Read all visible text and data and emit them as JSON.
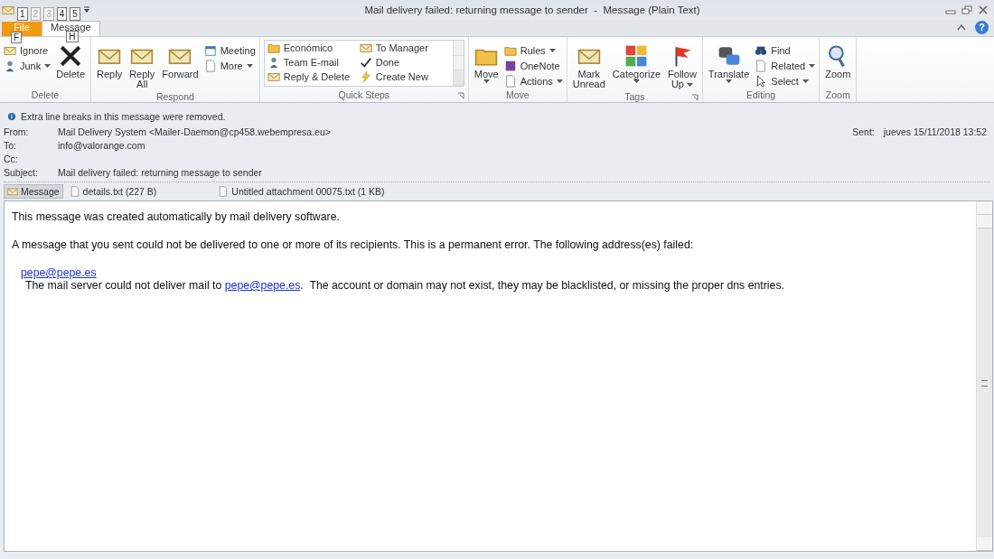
{
  "window": {
    "title": "Mail delivery failed: returning message to sender  -  Message (Plain Text)",
    "help": "?"
  },
  "quick_access": [
    {
      "keytip": "1",
      "disabled": false
    },
    {
      "keytip": "2",
      "disabled": true
    },
    {
      "keytip": "3",
      "disabled": true
    },
    {
      "keytip": "4",
      "disabled": false
    },
    {
      "keytip": "5",
      "disabled": false
    }
  ],
  "tabs": [
    {
      "label": "File",
      "kind": "file",
      "keytip": "F",
      "selected": false
    },
    {
      "label": "Message",
      "kind": "tab",
      "keytip": "H",
      "selected": true
    }
  ],
  "ribbon": [
    {
      "name": "Delete",
      "launcher": false,
      "items": [
        {
          "kind": "stack",
          "items": [
            {
              "label": "Ignore",
              "dropdown": false
            },
            {
              "label": "Junk",
              "dropdown": true
            }
          ]
        },
        {
          "kind": "large",
          "lines": [
            "Delete"
          ],
          "dropdown": false
        }
      ]
    },
    {
      "name": "Respond",
      "launcher": false,
      "items": [
        {
          "kind": "large",
          "lines": [
            "Reply"
          ],
          "dropdown": false
        },
        {
          "kind": "large",
          "lines": [
            "Reply",
            "All"
          ],
          "dropdown": false
        },
        {
          "kind": "large",
          "lines": [
            "Forward"
          ],
          "dropdown": false
        },
        {
          "kind": "stack",
          "items": [
            {
              "label": "Meeting",
              "dropdown": false
            },
            {
              "label": "More",
              "dropdown": true
            }
          ]
        }
      ]
    },
    {
      "name": "Quick Steps",
      "launcher": true,
      "items": [
        {
          "kind": "gallery",
          "items": [
            {
              "label": "Económico"
            },
            {
              "label": "Team E-mail"
            },
            {
              "label": "Reply & Delete"
            },
            {
              "label": "To Manager"
            },
            {
              "label": "Done"
            },
            {
              "label": "Create New"
            }
          ]
        }
      ]
    },
    {
      "name": "Move",
      "launcher": false,
      "items": [
        {
          "kind": "large",
          "lines": [
            "Move"
          ],
          "dropdown": true
        },
        {
          "kind": "stack",
          "items": [
            {
              "label": "Rules",
              "dropdown": true
            },
            {
              "label": "OneNote",
              "dropdown": false
            },
            {
              "label": "Actions",
              "dropdown": true
            }
          ]
        }
      ]
    },
    {
      "name": "Tags",
      "launcher": true,
      "items": [
        {
          "kind": "large",
          "lines": [
            "Mark",
            "Unread"
          ],
          "dropdown": false
        },
        {
          "kind": "large",
          "lines": [
            "Categorize"
          ],
          "dropdown": true
        },
        {
          "kind": "large",
          "lines": [
            "Follow",
            "Up"
          ],
          "dropdown": true
        }
      ]
    },
    {
      "name": "Editing",
      "launcher": false,
      "items": [
        {
          "kind": "large",
          "lines": [
            "Translate"
          ],
          "dropdown": true
        },
        {
          "kind": "stack",
          "items": [
            {
              "label": "Find",
              "dropdown": false
            },
            {
              "label": "Related",
              "dropdown": true
            },
            {
              "label": "Select",
              "dropdown": true
            }
          ]
        }
      ]
    },
    {
      "name": "Zoom",
      "launcher": false,
      "items": [
        {
          "kind": "large",
          "lines": [
            "Zoom"
          ],
          "dropdown": false
        }
      ]
    }
  ],
  "infobar": "Extra line breaks in this message were removed.",
  "header": {
    "fields": [
      {
        "label": "From:",
        "value": "Mail Delivery System <Mailer-Daemon@cp458.webempresa.eu>"
      },
      {
        "label": "To:",
        "value": "info@valorange.com"
      },
      {
        "label": "Cc:"
      },
      {
        "label": "Subject:",
        "value": "Mail delivery failed: returning message to sender"
      }
    ],
    "sent": {
      "label": "Sent:",
      "value": "jueves 15/11/2018 13:52"
    }
  },
  "attachments": [
    {
      "label": "Message",
      "kind": "message",
      "selected": true
    },
    {
      "label": "details.txt (227 B)",
      "kind": "file",
      "selected": false
    },
    {
      "label": "Untitled attachment 00075.txt (1 KB)",
      "kind": "file",
      "selected": false
    }
  ],
  "body": {
    "intro": "This message was created automatically by mail delivery software.",
    "notice": "A message that you sent could not be delivered to one or more of its recipients. This is a permanent error. The following address(es) failed:",
    "address": "pepe@pepe.es",
    "detail": {
      "before": "The mail server could not deliver mail to ",
      "link": "pepe@pepe.es",
      "after": ".  The account or domain may not exist, they may be blacklisted, or missing the proper dns entries."
    }
  }
}
